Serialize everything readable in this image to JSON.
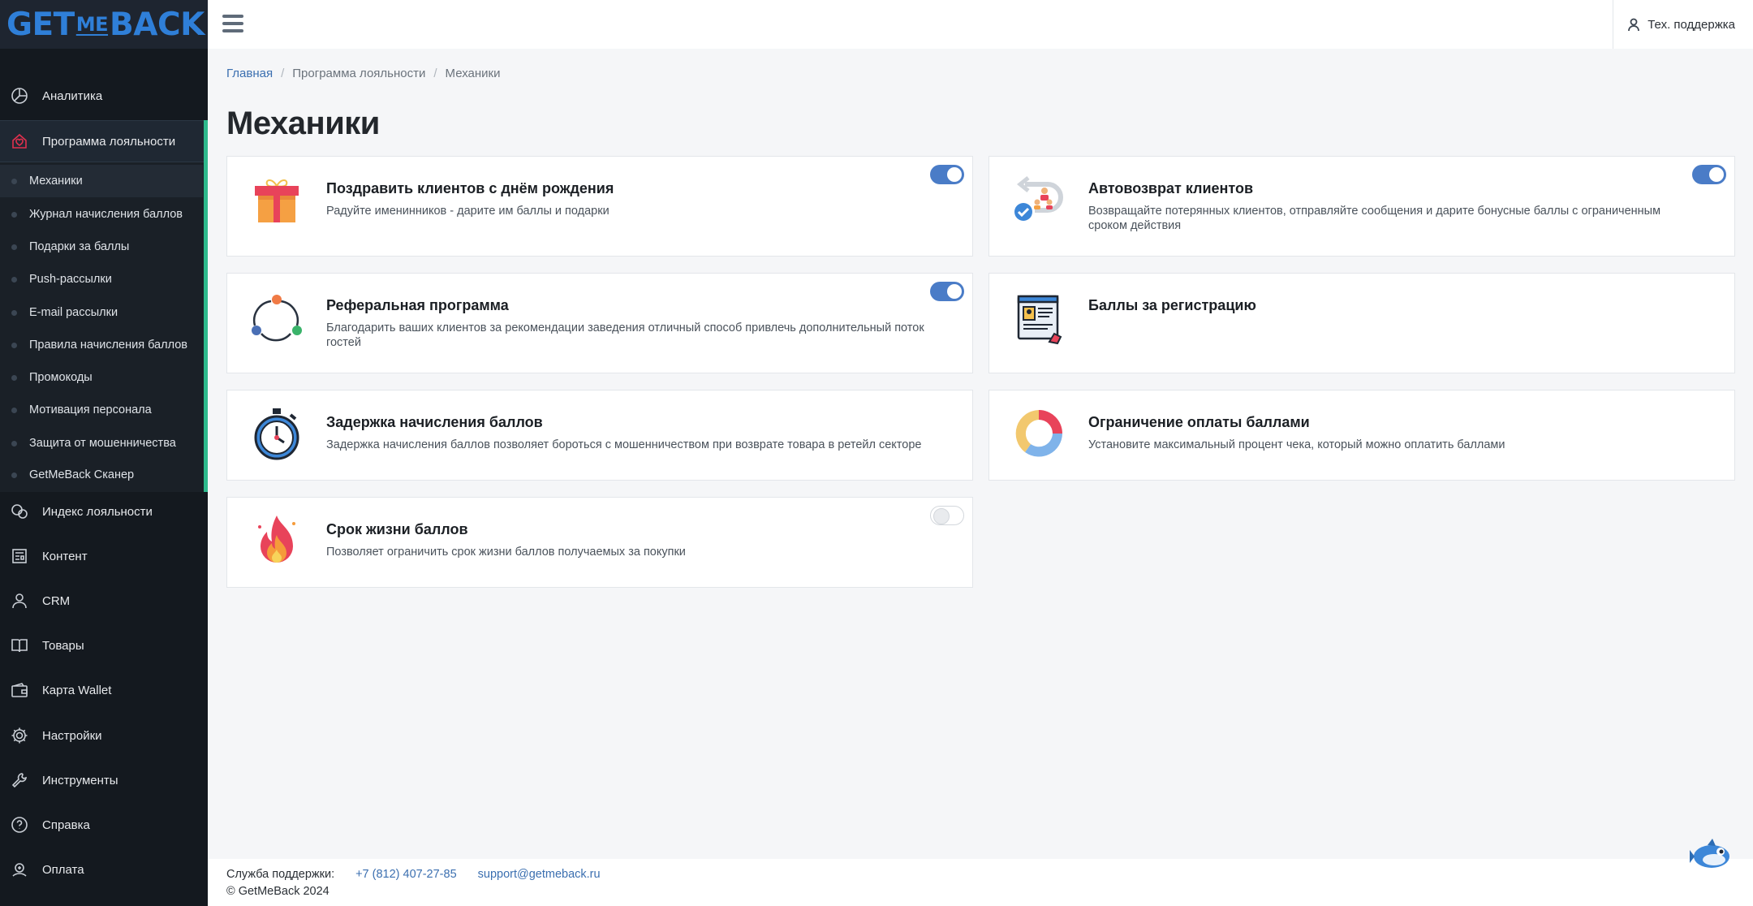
{
  "logo": {
    "get": "GET",
    "me": "ME",
    "back": "BACK"
  },
  "topbar": {
    "support": "Тех. поддержка"
  },
  "sidebar": {
    "items": [
      {
        "label": "Аналитика",
        "icon": "chart-pie-icon"
      },
      {
        "label": "Программа лояльности",
        "icon": "home-heart-icon"
      },
      {
        "label": "Индекс лояльности",
        "icon": "chat-icon"
      },
      {
        "label": "Контент",
        "icon": "content-icon"
      },
      {
        "label": "CRM",
        "icon": "user-icon"
      },
      {
        "label": "Товары",
        "icon": "book-icon"
      },
      {
        "label": "Карта Wallet",
        "icon": "wallet-icon"
      },
      {
        "label": "Настройки",
        "icon": "gear-icon"
      },
      {
        "label": "Инструменты",
        "icon": "wrench-icon"
      },
      {
        "label": "Справка",
        "icon": "question-icon"
      },
      {
        "label": "Оплата",
        "icon": "payment-icon"
      }
    ],
    "sub_items": [
      "Механики",
      "Журнал начисления баллов",
      "Подарки за баллы",
      "Push-рассылки",
      "E-mail рассылки",
      "Правила начисления баллов",
      "Промокоды",
      "Мотивация персонала",
      "Защита от мошенничества",
      "GetMeBack Сканер"
    ]
  },
  "breadcrumb": {
    "home": "Главная",
    "section": "Программа лояльности",
    "current": "Механики",
    "sep": "/"
  },
  "page_title": "Механики",
  "cards": [
    {
      "title": "Поздравить клиентов с днём рождения",
      "desc": "Радуйте именинников - дарите им баллы и подарки",
      "toggle": true,
      "icon": "gift-icon"
    },
    {
      "title": "Автовозврат клиентов",
      "desc": "Возвращайте потерянных клиентов, отправляйте сообщения и дарите бонусные баллы с ограниченным сроком действия",
      "toggle": true,
      "icon": "return-icon"
    },
    {
      "title": "Реферальная программа",
      "desc": "Благодарить ваших клиентов за рекомендации заведения отличный способ привлечь дополнительный поток гостей",
      "toggle": true,
      "icon": "referral-icon"
    },
    {
      "title": "Баллы за регистрацию",
      "desc": "",
      "toggle": null,
      "icon": "registration-icon"
    },
    {
      "title": "Задержка начисления баллов",
      "desc": "Задержка начисления баллов позволяет бороться с мошенничеством при возврате товара в ретейл секторе",
      "toggle": null,
      "icon": "stopwatch-icon"
    },
    {
      "title": "Ограничение оплаты баллами",
      "desc": "Установите максимальный процент чека, который можно оплатить баллами",
      "toggle": null,
      "icon": "donut-icon"
    },
    {
      "title": "Срок жизни баллов",
      "desc": "Позволяет ограничить срок жизни баллов получаемых за покупки",
      "toggle": false,
      "icon": "fire-icon"
    }
  ],
  "footer": {
    "support_label": "Служба поддержки:",
    "phone": "+7 (812) 407-27-85",
    "email": "support@getmeback.ru",
    "copyright": "© GetMeBack 2024"
  },
  "colors": {
    "accent": "#2eb98c",
    "link": "#3b6fb0",
    "toggle_on": "#4a7cc7",
    "sidebar": "#14191f"
  }
}
